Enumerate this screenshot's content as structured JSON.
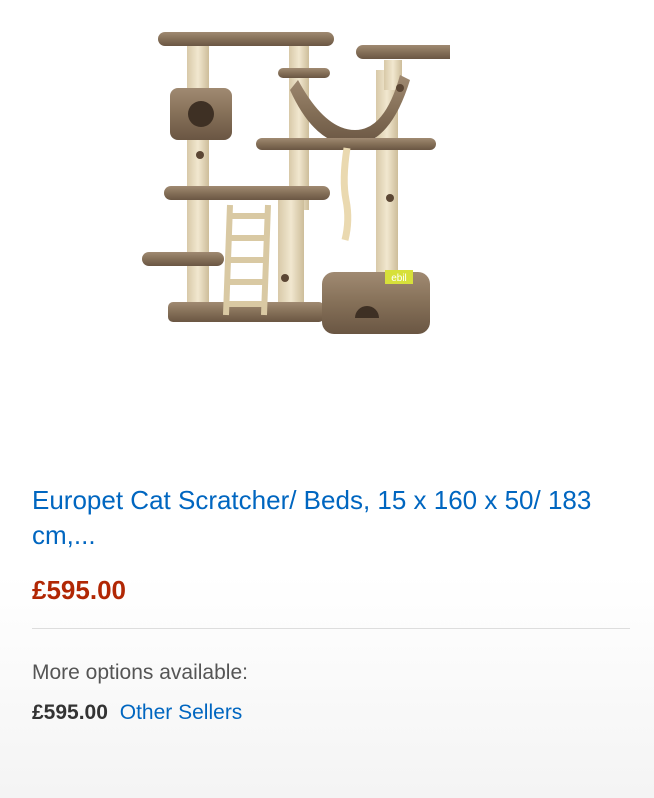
{
  "product": {
    "image_alt": "Cat scratcher tree",
    "image_tag_text": "ebil",
    "title": "Europet Cat Scratcher/ Beds, 15 x 160 x 50/ 183 cm,...",
    "price": "£595.00"
  },
  "more_options": {
    "label": "More options available:",
    "price": "£595.00",
    "link_label": "Other Sellers"
  },
  "colors": {
    "link": "#0066c0",
    "price": "#b12704",
    "fur": "#8a7560",
    "sisal": "#e9dcc0"
  }
}
